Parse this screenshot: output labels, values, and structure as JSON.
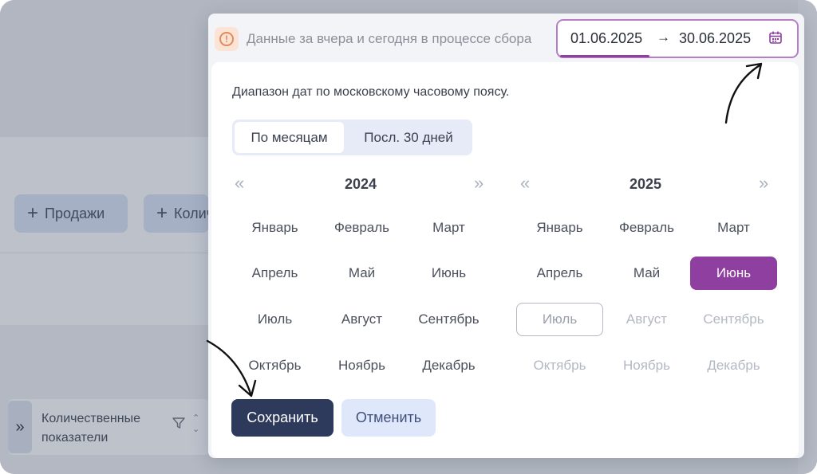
{
  "background": {
    "buttons": [
      {
        "label": "Продажи"
      },
      {
        "label": "Количество"
      }
    ],
    "card": {
      "title": "Количественные показатели"
    }
  },
  "notice": {
    "text": "Данные за вчера и сегодня в процессе сбора"
  },
  "range": {
    "from": "01.06.2025",
    "arrow": "→",
    "to": "30.06.2025"
  },
  "hint": "Диапазон дат по московскому часовому поясу.",
  "modes": {
    "months": "По месяцам",
    "last30": "Посл. 30 дней",
    "active": "months"
  },
  "calendars": [
    {
      "year": "2024",
      "months": [
        "Январь",
        "Февраль",
        "Март",
        "Апрель",
        "Май",
        "Июнь",
        "Июль",
        "Август",
        "Сентябрь",
        "Октябрь",
        "Ноябрь",
        "Декабрь"
      ]
    },
    {
      "year": "2025",
      "months": [
        "Январь",
        "Февраль",
        "Март",
        "Апрель",
        "Май",
        "Июнь",
        "Июль",
        "Август",
        "Сентябрь",
        "Октябрь",
        "Ноябрь",
        "Декабрь"
      ],
      "selected": "Июнь",
      "current": "Июль",
      "disabled": [
        "Июль",
        "Август",
        "Сентябрь",
        "Октябрь",
        "Ноябрь",
        "Декабрь"
      ]
    }
  ],
  "nav": {
    "prev": "«",
    "next": "»"
  },
  "actions": {
    "save": "Сохранить",
    "cancel": "Отменить"
  },
  "colors": {
    "accent": "#8e3f9f",
    "primary": "#2d3a5c",
    "warning": "#e58a56"
  },
  "icons": {
    "notice": "info-icon",
    "calendar": "calendar-icon"
  }
}
